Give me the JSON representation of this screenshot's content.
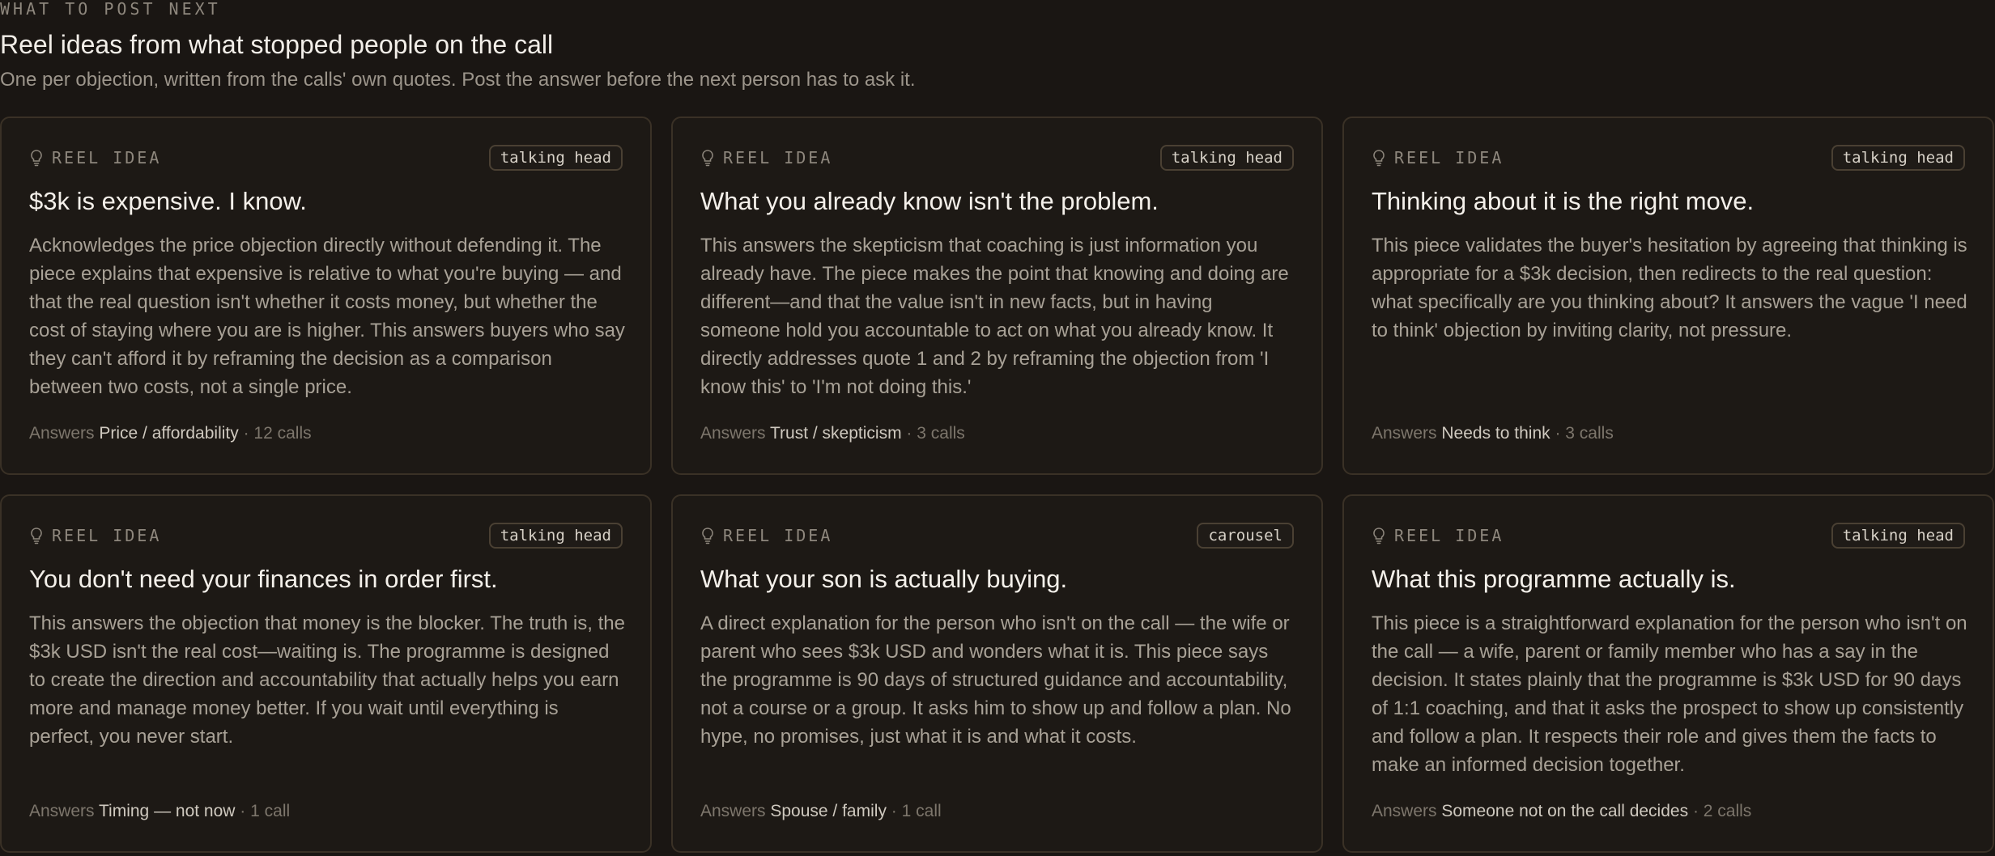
{
  "header": {
    "eyebrow": "WHAT TO POST NEXT",
    "title": "Reel ideas from what stopped people on the call",
    "subtitle": "One per objection, written from the calls' own quotes. Post the answer before the next person has to ask it."
  },
  "cards": [
    {
      "kicker": "REEL IDEA",
      "format": "talking head",
      "title": "$3k is expensive. I know.",
      "body": "Acknowledges the price objection directly without defending it. The piece explains that expensive is relative to what you're buying — and that the real question isn't whether it costs money, but whether the cost of staying where you are is higher. This answers buyers who say they can't afford it by reframing the decision as a comparison between two costs, not a single price.",
      "answers_label": "Answers",
      "objection": "Price / affordability",
      "calls": "· 12 calls"
    },
    {
      "kicker": "REEL IDEA",
      "format": "talking head",
      "title": "What you already know isn't the problem.",
      "body": "This answers the skepticism that coaching is just information you already have. The piece makes the point that knowing and doing are different—and that the value isn't in new facts, but in having someone hold you accountable to act on what you already know. It directly addresses quote 1 and 2 by reframing the objection from 'I know this' to 'I'm not doing this.'",
      "answers_label": "Answers",
      "objection": "Trust / skepticism",
      "calls": "· 3 calls"
    },
    {
      "kicker": "REEL IDEA",
      "format": "talking head",
      "title": "Thinking about it is the right move.",
      "body": "This piece validates the buyer's hesitation by agreeing that thinking is appropriate for a $3k decision, then redirects to the real question: what specifically are you thinking about? It answers the vague 'I need to think' objection by inviting clarity, not pressure.",
      "answers_label": "Answers",
      "objection": "Needs to think",
      "calls": "· 3 calls"
    },
    {
      "kicker": "REEL IDEA",
      "format": "talking head",
      "title": "You don't need your finances in order first.",
      "body": "This answers the objection that money is the blocker. The truth is, the $3k USD isn't the real cost—waiting is. The programme is designed to create the direction and accountability that actually helps you earn more and manage money better. If you wait until everything is perfect, you never start.",
      "answers_label": "Answers",
      "objection": "Timing — not now",
      "calls": "· 1 call"
    },
    {
      "kicker": "REEL IDEA",
      "format": "carousel",
      "title": "What your son is actually buying.",
      "body": "A direct explanation for the person who isn't on the call — the wife or parent who sees $3k USD and wonders what it is. This piece says the programme is 90 days of structured guidance and accountability, not a course or a group. It asks him to show up and follow a plan. No hype, no promises, just what it is and what it costs.",
      "answers_label": "Answers",
      "objection": "Spouse / family",
      "calls": "· 1 call"
    },
    {
      "kicker": "REEL IDEA",
      "format": "talking head",
      "title": "What this programme actually is.",
      "body": "This piece is a straightforward explanation for the person who isn't on the call — a wife, parent or family member who has a say in the decision. It states plainly that the programme is $3k USD for 90 days of 1:1 coaching, and that it asks the prospect to show up consistently and follow a plan. It respects their role and gives them the facts to make an informed decision together.",
      "answers_label": "Answers",
      "objection": "Someone not on the call decides",
      "calls": "· 2 calls"
    }
  ]
}
